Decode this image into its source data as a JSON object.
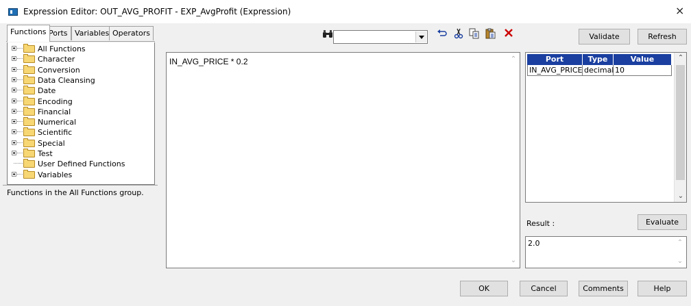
{
  "window": {
    "title": "Expression Editor: OUT_AVG_PROFIT - EXP_AvgProfit (Expression)",
    "close_glyph": "×"
  },
  "tabs": [
    {
      "label": "Functions",
      "active": true
    },
    {
      "label": "Ports",
      "active": false
    },
    {
      "label": "Variables",
      "active": false
    },
    {
      "label": "Operators",
      "active": false
    }
  ],
  "function_tree": [
    {
      "label": "All Functions",
      "expandable": true
    },
    {
      "label": "Character",
      "expandable": true
    },
    {
      "label": "Conversion",
      "expandable": true
    },
    {
      "label": "Data Cleansing",
      "expandable": true
    },
    {
      "label": "Date",
      "expandable": true
    },
    {
      "label": "Encoding",
      "expandable": true
    },
    {
      "label": "Financial",
      "expandable": true
    },
    {
      "label": "Numerical",
      "expandable": true
    },
    {
      "label": "Scientific",
      "expandable": true
    },
    {
      "label": "Special",
      "expandable": true
    },
    {
      "label": "Test",
      "expandable": true
    },
    {
      "label": "User Defined Functions",
      "expandable": false
    },
    {
      "label": "Variables",
      "expandable": true
    }
  ],
  "description": "Functions in the All Functions group.",
  "toolbar": {
    "search_value": "",
    "icons": [
      "binoculars-icon",
      "undo-icon",
      "cut-icon",
      "copy-icon",
      "paste-icon",
      "delete-icon"
    ]
  },
  "editor": {
    "expression": "IN_AVG_PRICE * 0.2"
  },
  "buttons": {
    "validate": "Validate",
    "refresh": "Refresh",
    "evaluate": "Evaluate",
    "ok": "OK",
    "cancel": "Cancel",
    "comments": "Comments",
    "help": "Help"
  },
  "port_grid": {
    "headers": [
      "Port",
      "Type",
      "Value"
    ],
    "rows": [
      [
        "IN_AVG_PRICE",
        "decimal",
        "10"
      ]
    ]
  },
  "result": {
    "label": "Result :",
    "value": "2.0"
  },
  "colors": {
    "grid_header": "#1a3fa0",
    "folder": "#f7d774",
    "delete_icon": "#cc0000"
  }
}
